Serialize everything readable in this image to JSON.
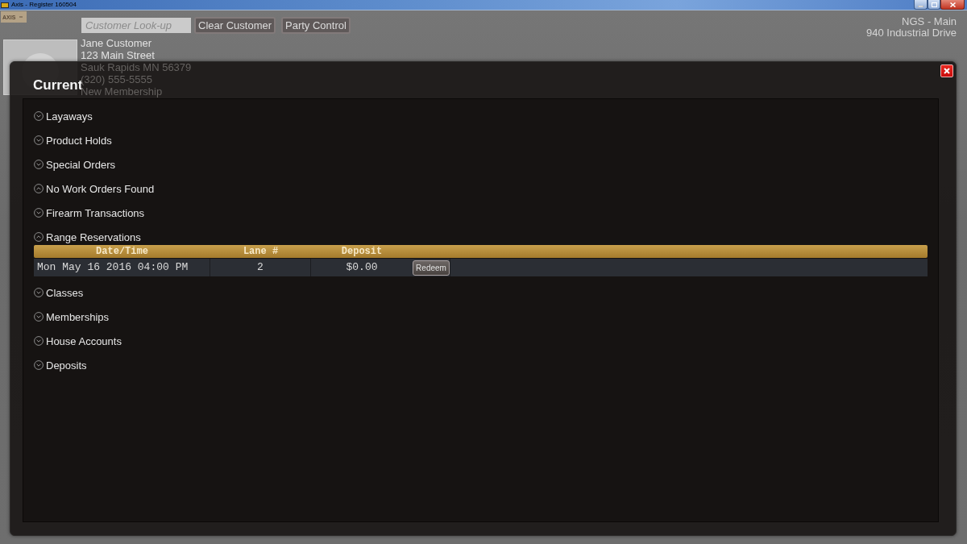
{
  "window": {
    "title": "Axis - Register 160504"
  },
  "toolbar": {
    "logo": "AXIS",
    "search": {
      "placeholder": "Customer Look-up"
    },
    "buttons": [
      "Clear Customer",
      "Party Control"
    ]
  },
  "store": {
    "name": "NGS - Main",
    "address": "940 Industrial Drive"
  },
  "customer": {
    "lines": [
      "Jane Customer",
      "123 Main Street",
      "Sauk Rapids MN 56379",
      "(320) 555-5555",
      "New Membership"
    ]
  },
  "dialog": {
    "title": "Current",
    "sections": [
      {
        "label": "Layaways",
        "expanded": false
      },
      {
        "label": "Product Holds",
        "expanded": false
      },
      {
        "label": "Special Orders",
        "expanded": false
      },
      {
        "label": "No Work Orders Found",
        "expanded": true
      },
      {
        "label": "Firearm Transactions",
        "expanded": false
      },
      {
        "label": "Range Reservations",
        "expanded": true,
        "table": {
          "columns": [
            "Date/Time",
            "Lane #",
            "Deposit"
          ],
          "rows": [
            {
              "cells": [
                "Mon May 16 2016 04:00 PM",
                "2",
                "$0.00"
              ],
              "action": "Redeem"
            }
          ]
        }
      },
      {
        "label": "Classes",
        "expanded": false
      },
      {
        "label": "Memberships",
        "expanded": false
      },
      {
        "label": "House Accounts",
        "expanded": false
      },
      {
        "label": "Deposits",
        "expanded": false
      }
    ]
  }
}
